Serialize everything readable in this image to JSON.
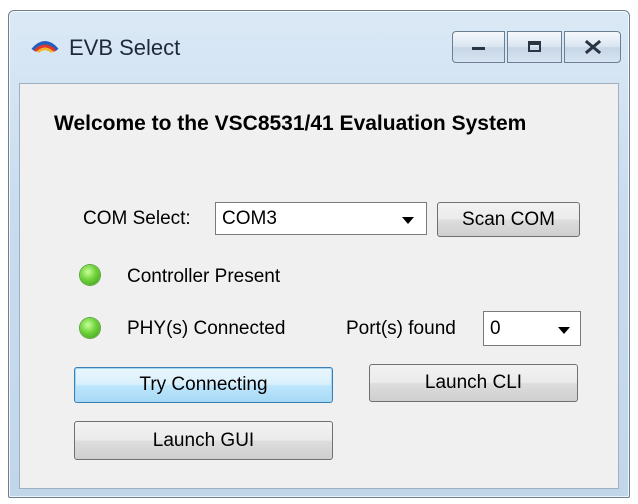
{
  "window": {
    "title": "EVB Select",
    "icon": "evb-logo-icon",
    "controls": {
      "minimize_icon": "minimize-icon",
      "maximize_icon": "maximize-icon",
      "close_icon": "close-icon"
    }
  },
  "main": {
    "welcome": "Welcome to the VSC8531/41 Evaluation System",
    "com_select_label": "COM Select:",
    "com_select_value": "COM3",
    "scan_com_label": "Scan COM",
    "controller_status": "Controller Present",
    "phy_status": "PHY(s) Connected",
    "ports_found_label": "Port(s) found",
    "ports_found_value": "0",
    "try_connecting_label": "Try Connecting",
    "launch_cli_label": "Launch CLI",
    "launch_gui_label": "Launch GUI"
  },
  "colors": {
    "led_on": "#6fd23a",
    "focus_border": "#3c7fb1"
  }
}
